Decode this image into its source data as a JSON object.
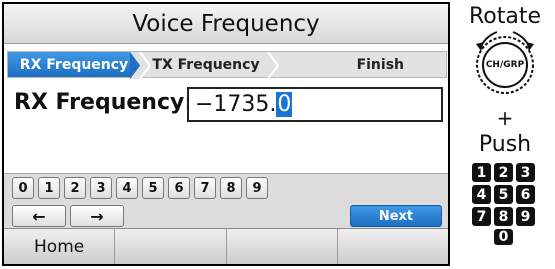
{
  "screen": {
    "title": "Voice Frequency",
    "steps": [
      {
        "label": "RX Frequency",
        "active": true
      },
      {
        "label": "TX Frequency",
        "active": false
      },
      {
        "label": "Finish",
        "active": false
      }
    ],
    "rx_label": "RX Frequency:",
    "rx_value": "−1735.",
    "rx_cursor_char": "0",
    "digit_keys": [
      "0",
      "1",
      "2",
      "3",
      "4",
      "5",
      "6",
      "7",
      "8",
      "9"
    ],
    "left_arrow": "←",
    "right_arrow": "→",
    "next_label": "Next",
    "softkeys": [
      "Home",
      "",
      "",
      ""
    ]
  },
  "side": {
    "rotate_label": "Rotate",
    "knob_label": "CH/GRP",
    "plus": "+",
    "push_label": "Push",
    "number_keys": [
      "1",
      "2",
      "3",
      "4",
      "5",
      "6",
      "7",
      "8",
      "9",
      "0"
    ]
  },
  "colors": {
    "accent": "#1f6fc2",
    "frame": "#000000"
  }
}
